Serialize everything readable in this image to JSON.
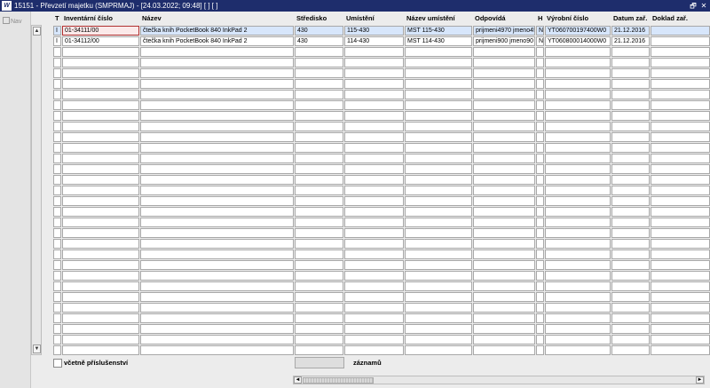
{
  "window": {
    "icon_glyph": "W",
    "title": "15151 - Převzetí majetku (SMPRMAJ) - [24.03.2022; 09:48] [ ] [ ]",
    "restore_glyph": "🗗",
    "close_glyph": "✕"
  },
  "nav": {
    "label": "Nav"
  },
  "columns": [
    {
      "key": "t",
      "label": "T"
    },
    {
      "key": "inv",
      "label": "Inventární číslo"
    },
    {
      "key": "nazev",
      "label": "Název"
    },
    {
      "key": "stredisko",
      "label": "Středisko"
    },
    {
      "key": "umisteni",
      "label": "Umístění"
    },
    {
      "key": "nazev_umisteni",
      "label": "Název umístění"
    },
    {
      "key": "odpovida",
      "label": "Odpovídá"
    },
    {
      "key": "h",
      "label": "H"
    },
    {
      "key": "vyrobni",
      "label": "Výrobní číslo"
    },
    {
      "key": "datum",
      "label": "Datum zař."
    },
    {
      "key": "doklad",
      "label": "Doklad zař."
    }
  ],
  "rows": [
    {
      "t": "I",
      "inv": "01-34111/00",
      "nazev": "čtečka knih PocketBook 840 InkPad 2",
      "stredisko": "430",
      "umisteni": "115-430",
      "nazev_umisteni": "MST 115-430",
      "odpovida": "prijmeni4970 jmeno4!",
      "h": "N",
      "vyrobni": "YT060700197400W0",
      "datum": "21.12.2016",
      "doklad": ""
    },
    {
      "t": "I",
      "inv": "01-34112/00",
      "nazev": "čtečka knih PocketBook 840 InkPad 2",
      "stredisko": "430",
      "umisteni": "114-430",
      "nazev_umisteni": "MST 114-430",
      "odpovida": "prijmeni900 jmeno90",
      "h": "N",
      "vyrobni": "YT060800014000W0",
      "datum": "21.12.2016",
      "doklad": ""
    }
  ],
  "footer": {
    "include_accessories_label": "včetně příslušenství",
    "include_accessories_checked": false,
    "records_count": "",
    "records_label": "záznamů"
  },
  "scroll": {
    "up": "▲",
    "down": "▼",
    "left": "◄",
    "right": "►"
  }
}
